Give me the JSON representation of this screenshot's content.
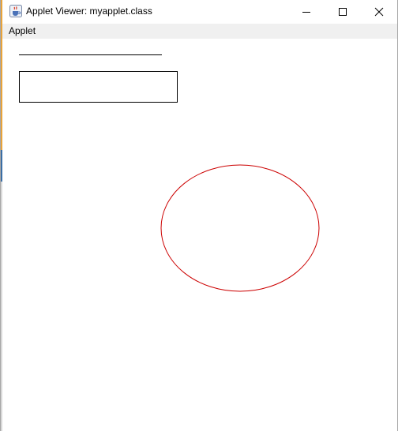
{
  "window": {
    "title": "Applet Viewer: myapplet.class",
    "icon": "java-cup-icon"
  },
  "title_buttons": {
    "minimize_icon": "minimize-icon",
    "maximize_icon": "maximize-icon",
    "close_icon": "close-icon"
  },
  "menubar": {
    "items": [
      {
        "label": "Applet"
      }
    ]
  },
  "canvas": {
    "shapes": [
      {
        "kind": "line",
        "color": "#000000"
      },
      {
        "kind": "rectangle",
        "color": "#000000"
      },
      {
        "kind": "oval",
        "color": "#cc0000"
      }
    ]
  }
}
